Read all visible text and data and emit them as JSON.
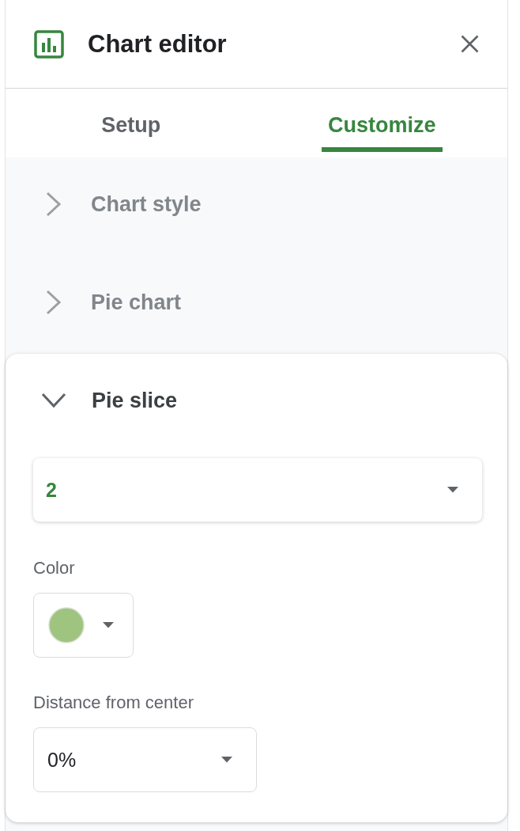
{
  "header": {
    "title": "Chart editor"
  },
  "tabs": [
    {
      "label": "Setup",
      "selected": false
    },
    {
      "label": "Customize",
      "selected": true
    }
  ],
  "sections": [
    {
      "title": "Chart style",
      "expanded": false
    },
    {
      "title": "Pie chart",
      "expanded": false
    },
    {
      "title": "Pie slice",
      "expanded": true,
      "fields": [
        {
          "kind": "slice-select",
          "value": "2"
        },
        {
          "kind": "color",
          "label": "Color",
          "color": "#9fc47f"
        },
        {
          "kind": "select",
          "label": "Distance from center",
          "value": "0%"
        }
      ]
    }
  ]
}
